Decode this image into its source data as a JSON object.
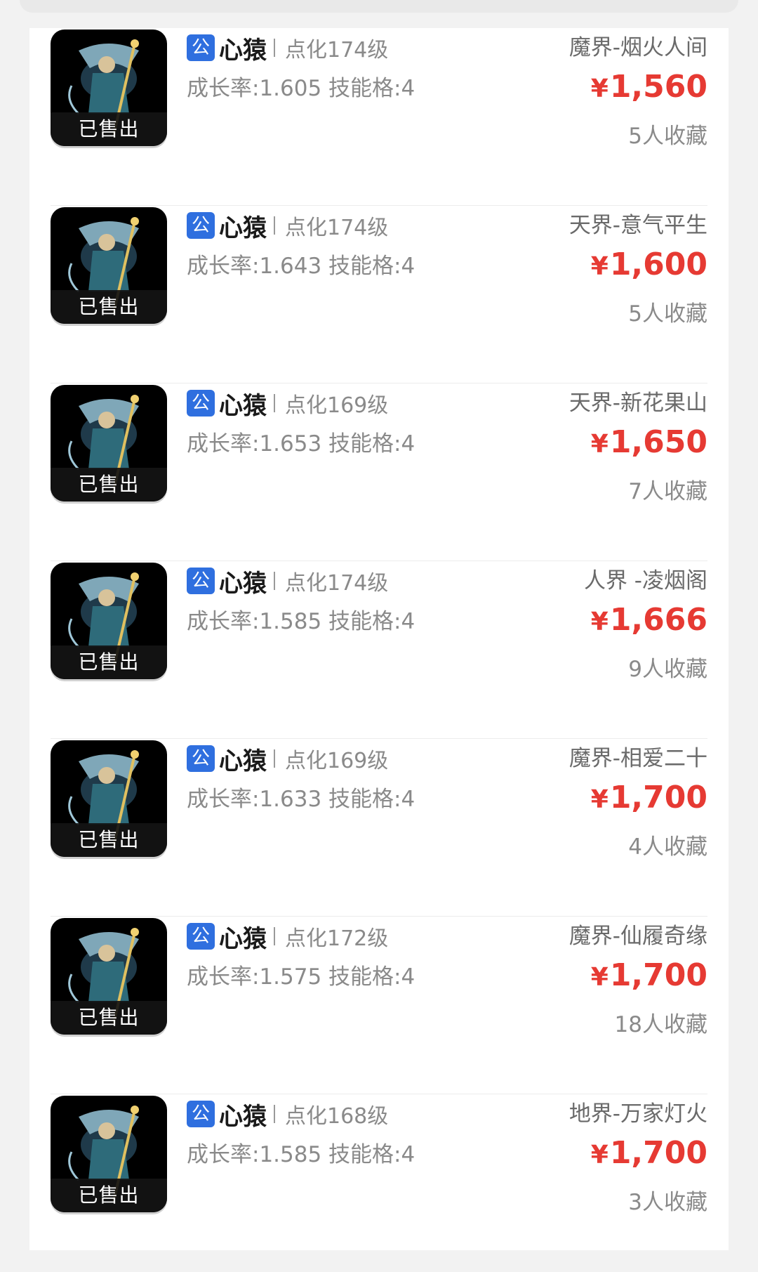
{
  "sold_label": "已售出",
  "badge": "公",
  "currency": "¥",
  "colors": {
    "price": "#e63a33",
    "badge": "#2f6fdf"
  },
  "items": [
    {
      "name": "心猿",
      "level": "点化174级",
      "stats": "成长率:1.605 技能格:4",
      "server": "魔界-烟火人间",
      "price": "1,560",
      "favs": "5人收藏"
    },
    {
      "name": "心猿",
      "level": "点化174级",
      "stats": "成长率:1.643 技能格:4",
      "server": "天界-意气平生",
      "price": "1,600",
      "favs": "5人收藏"
    },
    {
      "name": "心猿",
      "level": "点化169级",
      "stats": "成长率:1.653 技能格:4",
      "server": "天界-新花果山",
      "price": "1,650",
      "favs": "7人收藏"
    },
    {
      "name": "心猿",
      "level": "点化174级",
      "stats": "成长率:1.585 技能格:4",
      "server": "人界 -凌烟阁",
      "price": "1,666",
      "favs": "9人收藏"
    },
    {
      "name": "心猿",
      "level": "点化169级",
      "stats": "成长率:1.633 技能格:4",
      "server": "魔界-相爱二十",
      "price": "1,700",
      "favs": "4人收藏"
    },
    {
      "name": "心猿",
      "level": "点化172级",
      "stats": "成长率:1.575 技能格:4",
      "server": "魔界-仙履奇缘",
      "price": "1,700",
      "favs": "18人收藏"
    },
    {
      "name": "心猿",
      "level": "点化168级",
      "stats": "成长率:1.585 技能格:4",
      "server": "地界-万家灯火",
      "price": "1,700",
      "favs": "3人收藏"
    }
  ]
}
